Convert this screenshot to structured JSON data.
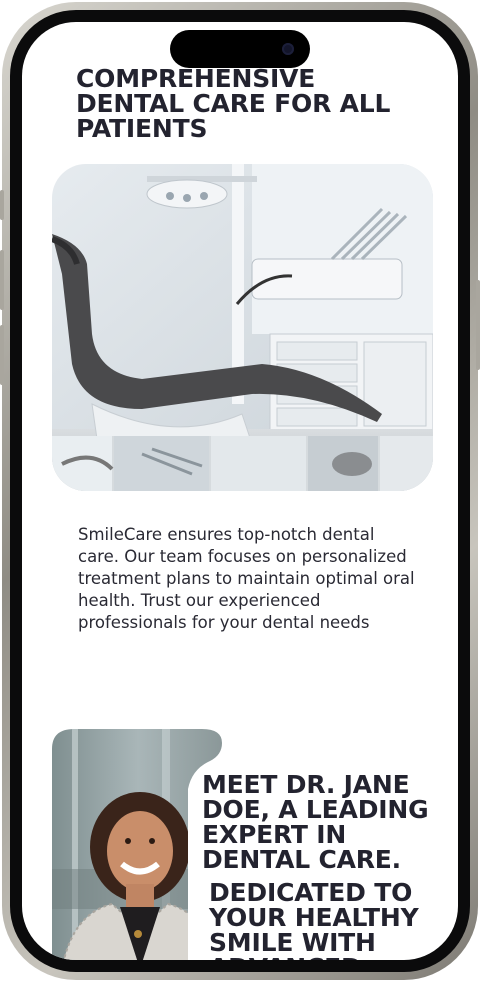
{
  "hero": {
    "headline": "Comprehensive dental care for all patients",
    "image": "dental-clinic-photo",
    "intro": "SmileCare ensures top-notch dental care. Our team focuses on personalized treatment plans to maintain optimal oral health. Trust our experienced professionals for your dental needs"
  },
  "doctor": {
    "image": "doctor-portrait-photo",
    "heading": "Meet Dr. Jane Doe, a leading expert in dental care.",
    "subheading": "Dedicated to your healthy smile with advanced"
  },
  "colors": {
    "text": "#23232f",
    "background": "#ffffff",
    "frame": "#0b0b0c"
  }
}
